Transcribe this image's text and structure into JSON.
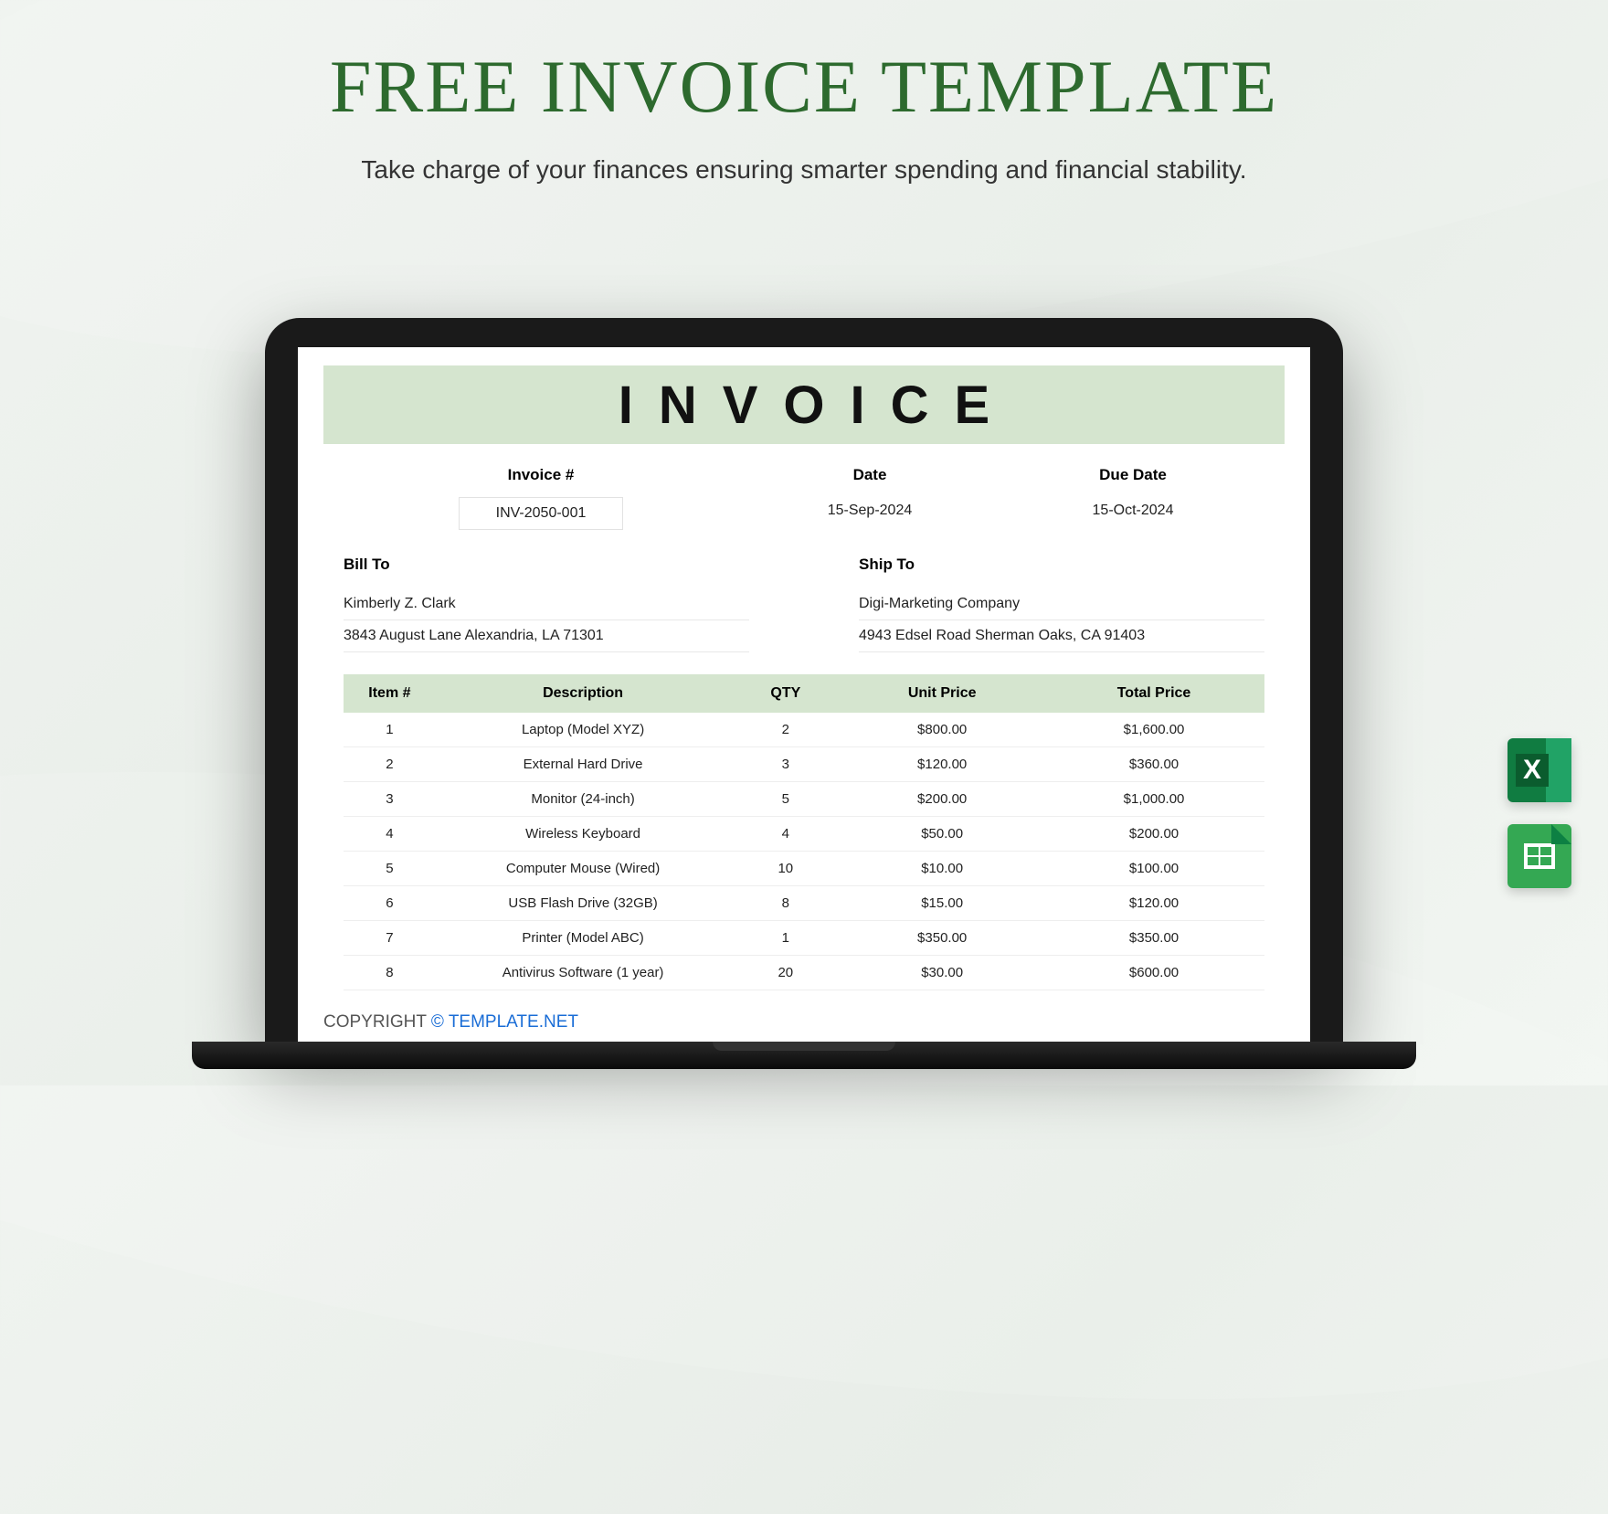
{
  "title": "FREE INVOICE TEMPLATE",
  "subtitle": "Take charge of your finances ensuring smarter spending and financial stability.",
  "invoice": {
    "header": "INVOICE",
    "meta": {
      "invoice_num_label": "Invoice #",
      "invoice_num": "INV-2050-001",
      "date_label": "Date",
      "date": "15-Sep-2024",
      "due_label": "Due Date",
      "due": "15-Oct-2024"
    },
    "bill_to": {
      "label": "Bill To",
      "name": "Kimberly Z. Clark",
      "address": "3843 August Lane Alexandria, LA 71301"
    },
    "ship_to": {
      "label": "Ship To",
      "name": "Digi-Marketing Company",
      "address": "4943 Edsel Road Sherman Oaks, CA 91403"
    },
    "columns": {
      "item": "Item #",
      "desc": "Description",
      "qty": "QTY",
      "unit": "Unit Price",
      "total": "Total Price"
    },
    "rows": [
      {
        "n": "1",
        "desc": "Laptop (Model XYZ)",
        "qty": "2",
        "unit": "$800.00",
        "total": "$1,600.00"
      },
      {
        "n": "2",
        "desc": "External Hard Drive",
        "qty": "3",
        "unit": "$120.00",
        "total": "$360.00"
      },
      {
        "n": "3",
        "desc": "Monitor (24-inch)",
        "qty": "5",
        "unit": "$200.00",
        "total": "$1,000.00"
      },
      {
        "n": "4",
        "desc": "Wireless Keyboard",
        "qty": "4",
        "unit": "$50.00",
        "total": "$200.00"
      },
      {
        "n": "5",
        "desc": "Computer Mouse (Wired)",
        "qty": "10",
        "unit": "$10.00",
        "total": "$100.00"
      },
      {
        "n": "6",
        "desc": "USB Flash Drive (32GB)",
        "qty": "8",
        "unit": "$15.00",
        "total": "$120.00"
      },
      {
        "n": "7",
        "desc": "Printer (Model ABC)",
        "qty": "1",
        "unit": "$350.00",
        "total": "$350.00"
      },
      {
        "n": "8",
        "desc": "Antivirus Software (1 year)",
        "qty": "20",
        "unit": "$30.00",
        "total": "$600.00"
      }
    ]
  },
  "copyright": {
    "prefix": "COPYRIGHT ",
    "link": "© TEMPLATE.NET"
  },
  "icons": {
    "excel": "X"
  }
}
